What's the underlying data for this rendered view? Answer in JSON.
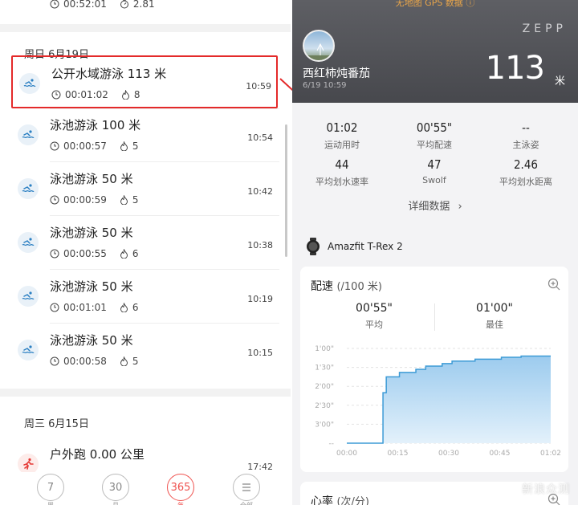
{
  "left": {
    "top_item": {
      "duration": "00:52:01",
      "value": "2.81"
    },
    "groups": [
      {
        "date": "周日 6月19日",
        "items": [
          {
            "title": "公开水域游泳 113 米",
            "duration": "00:01:02",
            "calories": "8",
            "time": "10:59",
            "highlighted": true
          },
          {
            "title": "泳池游泳 100 米",
            "duration": "00:00:57",
            "calories": "5",
            "time": "10:54"
          },
          {
            "title": "泳池游泳 50 米",
            "duration": "00:00:59",
            "calories": "5",
            "time": "10:42"
          },
          {
            "title": "泳池游泳 50 米",
            "duration": "00:00:55",
            "calories": "6",
            "time": "10:38"
          },
          {
            "title": "泳池游泳 50 米",
            "duration": "00:01:01",
            "calories": "6",
            "time": "10:19"
          },
          {
            "title": "泳池游泳 50 米",
            "duration": "00:00:58",
            "calories": "5",
            "time": "10:15"
          }
        ]
      },
      {
        "date": "周三 6月15日",
        "items": [
          {
            "title": "户外跑 0.00 公里",
            "time": "17:42"
          }
        ]
      }
    ],
    "tabs": [
      {
        "num": "7",
        "label": "周"
      },
      {
        "num": "30",
        "label": "月"
      },
      {
        "num": "365",
        "label": "年",
        "active": true
      },
      {
        "label": "全部"
      }
    ]
  },
  "right": {
    "gps_note": "无地图 GPS 数据",
    "brand": "ZEPP",
    "user_name": "西红柿炖番茄",
    "date_time": "6/19 10:59",
    "distance": "113",
    "distance_unit": "米",
    "stats": [
      {
        "value": "01:02",
        "label": "运动用时"
      },
      {
        "value": "00'55\"",
        "label": "平均配速"
      },
      {
        "value": "--",
        "label": "主泳姿"
      },
      {
        "value": "44",
        "label": "平均划水速率"
      },
      {
        "value": "47",
        "label": "Swolf"
      },
      {
        "value": "2.46",
        "label": "平均划水距离"
      }
    ],
    "more_label": "详细数据",
    "device_name": "Amazfit T-Rex 2",
    "pace_card": {
      "title": "配速",
      "subtitle": "(/100 米)",
      "avg_value": "00'55\"",
      "avg_label": "平均",
      "best_value": "01'00\"",
      "best_label": "最佳"
    },
    "hr_card": {
      "title": "心率",
      "subtitle": "(次/分)"
    },
    "watermark": "新浪众测"
  },
  "chart_data": {
    "type": "area",
    "title": "配速",
    "xlabel": "",
    "ylabel": "",
    "x_ticks": [
      "00:00",
      "00:15",
      "00:30",
      "00:45",
      "01:02"
    ],
    "y_ticks": [
      "1'00\"",
      "1'30\"",
      "2'00\"",
      "2'30\"",
      "3'00\"",
      "--"
    ],
    "x_seconds": [
      0,
      11,
      12,
      16,
      21,
      24,
      29,
      32,
      39,
      47,
      53,
      62
    ],
    "y_seconds_per_100m": [
      null,
      130,
      105,
      98,
      93,
      88,
      84,
      80,
      77,
      74,
      72,
      72
    ],
    "x_range_seconds": [
      0,
      62
    ],
    "y_range_seconds_per_100m": [
      210,
      60
    ],
    "grid": "horizontal dashed",
    "color": "#3d9bd6"
  }
}
